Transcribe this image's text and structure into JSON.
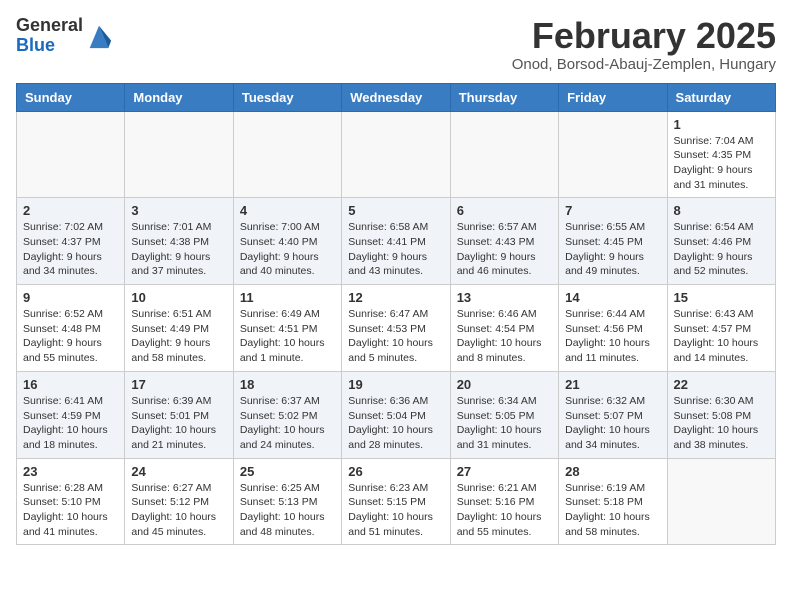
{
  "logo": {
    "general": "General",
    "blue": "Blue"
  },
  "title": "February 2025",
  "location": "Onod, Borsod-Abauj-Zemplen, Hungary",
  "days_of_week": [
    "Sunday",
    "Monday",
    "Tuesday",
    "Wednesday",
    "Thursday",
    "Friday",
    "Saturday"
  ],
  "weeks": [
    [
      {
        "day": "",
        "info": ""
      },
      {
        "day": "",
        "info": ""
      },
      {
        "day": "",
        "info": ""
      },
      {
        "day": "",
        "info": ""
      },
      {
        "day": "",
        "info": ""
      },
      {
        "day": "",
        "info": ""
      },
      {
        "day": "1",
        "info": "Sunrise: 7:04 AM\nSunset: 4:35 PM\nDaylight: 9 hours and 31 minutes."
      }
    ],
    [
      {
        "day": "2",
        "info": "Sunrise: 7:02 AM\nSunset: 4:37 PM\nDaylight: 9 hours and 34 minutes."
      },
      {
        "day": "3",
        "info": "Sunrise: 7:01 AM\nSunset: 4:38 PM\nDaylight: 9 hours and 37 minutes."
      },
      {
        "day": "4",
        "info": "Sunrise: 7:00 AM\nSunset: 4:40 PM\nDaylight: 9 hours and 40 minutes."
      },
      {
        "day": "5",
        "info": "Sunrise: 6:58 AM\nSunset: 4:41 PM\nDaylight: 9 hours and 43 minutes."
      },
      {
        "day": "6",
        "info": "Sunrise: 6:57 AM\nSunset: 4:43 PM\nDaylight: 9 hours and 46 minutes."
      },
      {
        "day": "7",
        "info": "Sunrise: 6:55 AM\nSunset: 4:45 PM\nDaylight: 9 hours and 49 minutes."
      },
      {
        "day": "8",
        "info": "Sunrise: 6:54 AM\nSunset: 4:46 PM\nDaylight: 9 hours and 52 minutes."
      }
    ],
    [
      {
        "day": "9",
        "info": "Sunrise: 6:52 AM\nSunset: 4:48 PM\nDaylight: 9 hours and 55 minutes."
      },
      {
        "day": "10",
        "info": "Sunrise: 6:51 AM\nSunset: 4:49 PM\nDaylight: 9 hours and 58 minutes."
      },
      {
        "day": "11",
        "info": "Sunrise: 6:49 AM\nSunset: 4:51 PM\nDaylight: 10 hours and 1 minute."
      },
      {
        "day": "12",
        "info": "Sunrise: 6:47 AM\nSunset: 4:53 PM\nDaylight: 10 hours and 5 minutes."
      },
      {
        "day": "13",
        "info": "Sunrise: 6:46 AM\nSunset: 4:54 PM\nDaylight: 10 hours and 8 minutes."
      },
      {
        "day": "14",
        "info": "Sunrise: 6:44 AM\nSunset: 4:56 PM\nDaylight: 10 hours and 11 minutes."
      },
      {
        "day": "15",
        "info": "Sunrise: 6:43 AM\nSunset: 4:57 PM\nDaylight: 10 hours and 14 minutes."
      }
    ],
    [
      {
        "day": "16",
        "info": "Sunrise: 6:41 AM\nSunset: 4:59 PM\nDaylight: 10 hours and 18 minutes."
      },
      {
        "day": "17",
        "info": "Sunrise: 6:39 AM\nSunset: 5:01 PM\nDaylight: 10 hours and 21 minutes."
      },
      {
        "day": "18",
        "info": "Sunrise: 6:37 AM\nSunset: 5:02 PM\nDaylight: 10 hours and 24 minutes."
      },
      {
        "day": "19",
        "info": "Sunrise: 6:36 AM\nSunset: 5:04 PM\nDaylight: 10 hours and 28 minutes."
      },
      {
        "day": "20",
        "info": "Sunrise: 6:34 AM\nSunset: 5:05 PM\nDaylight: 10 hours and 31 minutes."
      },
      {
        "day": "21",
        "info": "Sunrise: 6:32 AM\nSunset: 5:07 PM\nDaylight: 10 hours and 34 minutes."
      },
      {
        "day": "22",
        "info": "Sunrise: 6:30 AM\nSunset: 5:08 PM\nDaylight: 10 hours and 38 minutes."
      }
    ],
    [
      {
        "day": "23",
        "info": "Sunrise: 6:28 AM\nSunset: 5:10 PM\nDaylight: 10 hours and 41 minutes."
      },
      {
        "day": "24",
        "info": "Sunrise: 6:27 AM\nSunset: 5:12 PM\nDaylight: 10 hours and 45 minutes."
      },
      {
        "day": "25",
        "info": "Sunrise: 6:25 AM\nSunset: 5:13 PM\nDaylight: 10 hours and 48 minutes."
      },
      {
        "day": "26",
        "info": "Sunrise: 6:23 AM\nSunset: 5:15 PM\nDaylight: 10 hours and 51 minutes."
      },
      {
        "day": "27",
        "info": "Sunrise: 6:21 AM\nSunset: 5:16 PM\nDaylight: 10 hours and 55 minutes."
      },
      {
        "day": "28",
        "info": "Sunrise: 6:19 AM\nSunset: 5:18 PM\nDaylight: 10 hours and 58 minutes."
      },
      {
        "day": "",
        "info": ""
      }
    ]
  ]
}
